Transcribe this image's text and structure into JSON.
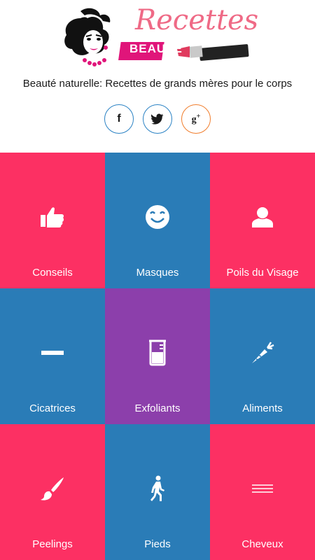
{
  "header": {
    "logo_text": "Recettes",
    "logo_subtext": "BEAUTÉ",
    "tagline": "Beauté naturelle: Recettes de grands mères pour le corps"
  },
  "social": [
    {
      "name": "facebook",
      "glyph": "f",
      "color": "#2a82c4"
    },
    {
      "name": "twitter",
      "glyph": "twitter-bird-icon",
      "color": "#2a82c4"
    },
    {
      "name": "google-plus",
      "glyph": "g+",
      "color": "#f07d2c"
    }
  ],
  "colors": {
    "pink": "#fc3063",
    "blue": "#2a7cb7",
    "purple": "#8c3fab",
    "logo_pink": "#ef6a86"
  },
  "tiles": [
    {
      "label": "Conseils",
      "icon": "thumbs-up-icon"
    },
    {
      "label": "Masques",
      "icon": "smiley-icon"
    },
    {
      "label": "Poils du Visage",
      "icon": "user-icon"
    },
    {
      "label": "Cicatrices",
      "icon": "minus-icon"
    },
    {
      "label": "Exfoliants",
      "icon": "beaker-icon"
    },
    {
      "label": "Aliments",
      "icon": "carrot-icon"
    },
    {
      "label": "Peelings",
      "icon": "paintbrush-icon"
    },
    {
      "label": "Pieds",
      "icon": "walking-person-icon"
    },
    {
      "label": "Cheveux",
      "icon": "hair-lines-icon"
    }
  ]
}
